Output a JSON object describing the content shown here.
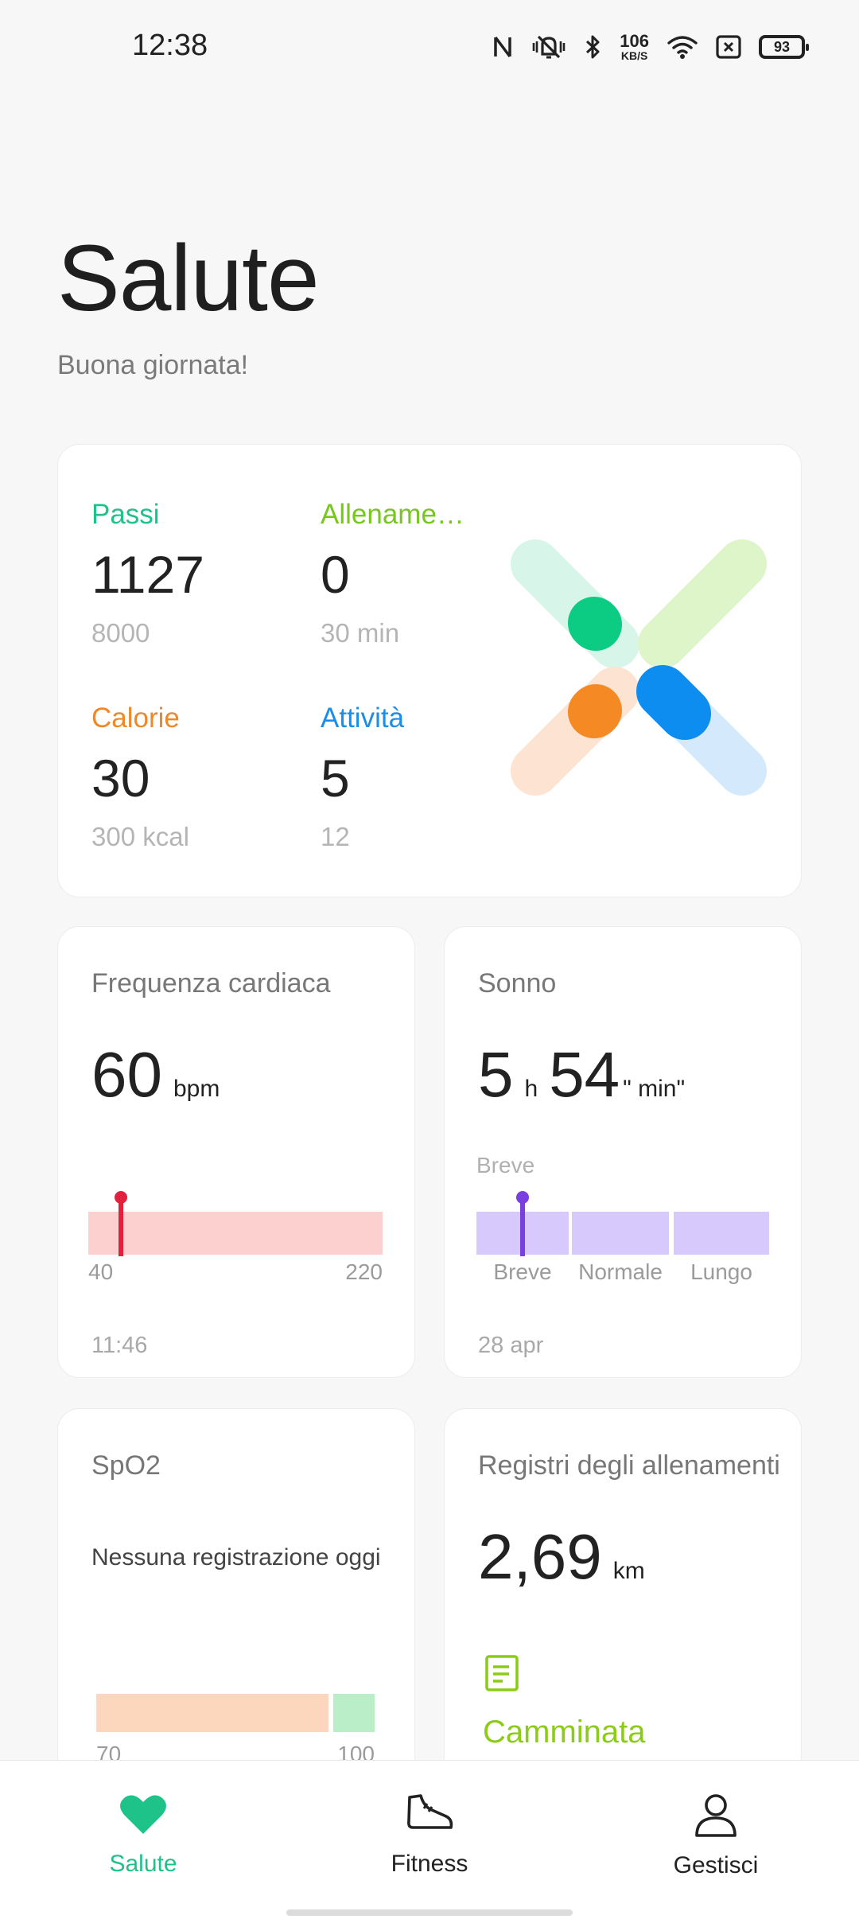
{
  "status_bar": {
    "time": "12:38",
    "net_speed_value": "106",
    "net_speed_unit": "KB/S",
    "battery": "93",
    "icons": [
      "nfc-icon",
      "vibrate-mute-icon",
      "bluetooth-icon",
      "wifi-icon",
      "sim-off-icon",
      "battery-icon"
    ]
  },
  "header": {
    "title": "Salute",
    "greeting": "Buona giornata!"
  },
  "summary": {
    "steps": {
      "label": "Passi",
      "value": "1127",
      "goal": "8000",
      "color": "#1ec389"
    },
    "workout": {
      "label": "Allename…",
      "value": "0",
      "goal": "30 min",
      "color": "#77c81d"
    },
    "calories": {
      "label": "Calorie",
      "value": "30",
      "goal": "300 kcal",
      "color": "#f08826"
    },
    "activity": {
      "label": "Attività",
      "value": "5",
      "goal": "12",
      "color": "#1a8ee8"
    }
  },
  "heart_rate": {
    "title": "Frequenza cardiaca",
    "value": "60",
    "unit": "bpm",
    "range_min": "40",
    "range_max": "220",
    "time": "11:46",
    "level_fraction": 0.11,
    "color": "#e0223f"
  },
  "sleep": {
    "title": "Sonno",
    "hours": "5",
    "hours_unit": "h",
    "minutes": "54",
    "minutes_unit": "\" min\"",
    "current_label": "Breve",
    "segments": [
      "Breve",
      "Normale",
      "Lungo"
    ],
    "date": "28 apr",
    "color": "#7a3fe0"
  },
  "spo2": {
    "title": "SpO2",
    "message": "Nessuna registrazione oggi",
    "range_min": "70",
    "range_max": "100"
  },
  "workouts": {
    "title": "Registri degli allenamenti",
    "value": "2,69",
    "unit": "km",
    "activity": "Camminata",
    "color": "#8ccc16"
  },
  "nav": {
    "items": [
      {
        "label": "Salute",
        "icon": "heart-icon",
        "active": true
      },
      {
        "label": "Fitness",
        "icon": "shoe-icon",
        "active": false
      },
      {
        "label": "Gestisci",
        "icon": "person-icon",
        "active": false
      }
    ],
    "active_color": "#1ec389"
  }
}
